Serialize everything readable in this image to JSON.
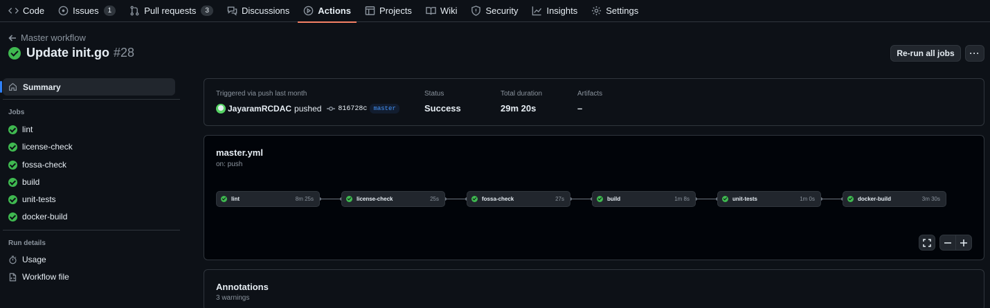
{
  "nav": {
    "tabs": [
      {
        "label": "Code",
        "icon": "code-icon"
      },
      {
        "label": "Issues",
        "icon": "issue-icon",
        "count": "1"
      },
      {
        "label": "Pull requests",
        "icon": "pull-request-icon",
        "count": "3"
      },
      {
        "label": "Discussions",
        "icon": "discussion-icon"
      },
      {
        "label": "Actions",
        "icon": "play-icon",
        "active": true
      },
      {
        "label": "Projects",
        "icon": "table-icon"
      },
      {
        "label": "Wiki",
        "icon": "book-icon"
      },
      {
        "label": "Security",
        "icon": "shield-icon"
      },
      {
        "label": "Insights",
        "icon": "graph-icon"
      },
      {
        "label": "Settings",
        "icon": "gear-icon"
      }
    ]
  },
  "header": {
    "back_label": "Master workflow",
    "title": "Update init.go",
    "run_number": "#28",
    "rerun_label": "Re-run all jobs",
    "more_label": "···"
  },
  "sidebar": {
    "summary_label": "Summary",
    "jobs_heading": "Jobs",
    "jobs": [
      "lint",
      "license-check",
      "fossa-check",
      "build",
      "unit-tests",
      "docker-build"
    ],
    "run_details_heading": "Run details",
    "usage_label": "Usage",
    "workflow_file_label": "Workflow file"
  },
  "summary": {
    "trigger_label": "Triggered via push last month",
    "user": "JayaramRCDAC",
    "action": "pushed",
    "commit": "816728c",
    "branch": "master",
    "status_label": "Status",
    "status": "Success",
    "duration_label": "Total duration",
    "duration": "29m 20s",
    "artifacts_label": "Artifacts",
    "artifacts": "–"
  },
  "workflow": {
    "name": "master.yml",
    "trigger": "on: push",
    "jobs": [
      {
        "name": "lint",
        "duration": "8m 25s"
      },
      {
        "name": "license-check",
        "duration": "25s"
      },
      {
        "name": "fossa-check",
        "duration": "27s"
      },
      {
        "name": "build",
        "duration": "1m 8s"
      },
      {
        "name": "unit-tests",
        "duration": "1m 0s"
      },
      {
        "name": "docker-build",
        "duration": "3m 30s"
      }
    ]
  },
  "annotations": {
    "title": "Annotations",
    "subtitle": "3 warnings"
  },
  "colors": {
    "success": "#3fb950",
    "accent": "#2f81f7",
    "active_tab_underline": "#f78166",
    "background": "#0d1117"
  }
}
